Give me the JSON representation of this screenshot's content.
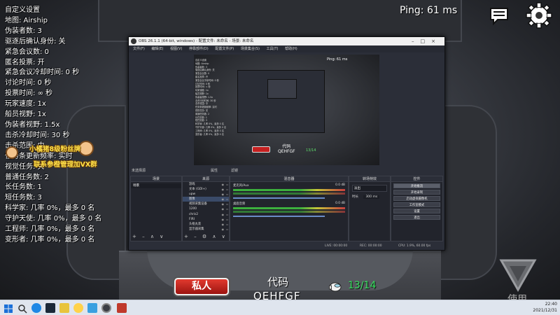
{
  "settings": [
    "自定义设置",
    "地图: Airship",
    "伪装者数: 3",
    "驱逐后确认身份: 关",
    "紧急会议数: 0",
    "匿名投票: 开",
    "紧急会议冷却时间: 0 秒",
    "讨论时间: 0 秒",
    "投票时间: ∞ 秒",
    "玩家速度: 1x",
    "船员视野: 1x",
    "伪装者视野: 1.5x",
    "击杀冷却时间: 30 秒",
    "击杀范围: 中",
    "任务条更新频率: 实时",
    "视觉任务: 关",
    "普通任务数: 2",
    "长任务数: 1",
    "短任务数: 3",
    "科学家: 几率 0%，最多 0 名",
    "守护天使: 几率 0%，最多 0 名",
    "工程师: 几率 0%，最多 0 名",
    "变形者: 几率 0%，最多 0 名"
  ],
  "streamer_badge": {
    "line1": "小橘猪8级粉丝牌",
    "line2": "联系参橙管理加VX群"
  },
  "hud": {
    "ping": "Ping: 61 ms",
    "private_button": "私人",
    "code_label": "代码",
    "code_value": "QEHFGF",
    "player_count": "13/14",
    "use_label": "使用"
  },
  "obs": {
    "title": "OBS 26.1.1 (64-bit, windows) - 配置文件: 未命名 - 场景: 未命名",
    "menu": [
      "文件(F)",
      "编辑(E)",
      "视图(V)",
      "停靠部件(D)",
      "配置文件(P)",
      "场景集合(S)",
      "工具(T)",
      "帮助(H)"
    ],
    "no_source": "未选择源",
    "properties": "属性",
    "filters": "滤镜",
    "docks": {
      "scenes": "场景",
      "sources": "来源",
      "mixer": "混音器",
      "transitions": "转场特效",
      "controls": "控件"
    },
    "scene_items": [
      "场景"
    ],
    "sources": [
      "游戏",
      "文本 (GDI+)",
      "upw",
      "图像",
      "视频采集设备",
      "1200",
      "chris2",
      "FIRI",
      "头框丸装",
      "显示器采集"
    ],
    "mixer": [
      {
        "name": "麦克风/Aux",
        "db": "0.0 dB"
      },
      {
        "name": "桌面音频",
        "db": "0.0 dB"
      }
    ],
    "transition": {
      "type": "淡出",
      "duration_label": "时长",
      "duration": "300 ms"
    },
    "controls": [
      "开始推流",
      "开始录制",
      "启动虚拟摄像机",
      "工作室模式",
      "设置",
      "退出"
    ],
    "status": {
      "live": "LIVE: 00:00:00",
      "rec": "REC: 00:00:00",
      "cpu": "CPU: 1.9%, 60.00 fps"
    }
  },
  "mini": {
    "ping": "Ping: 61 ms",
    "code": "代码",
    "code_value": "QEHFGF",
    "count": "13/14"
  },
  "taskbar": {
    "time": "22:40",
    "date": "2021/12/31"
  },
  "colors": {
    "private_red": "#c52020",
    "player_count_green": "#38e060",
    "badge_yellow": "#ffe14a"
  }
}
